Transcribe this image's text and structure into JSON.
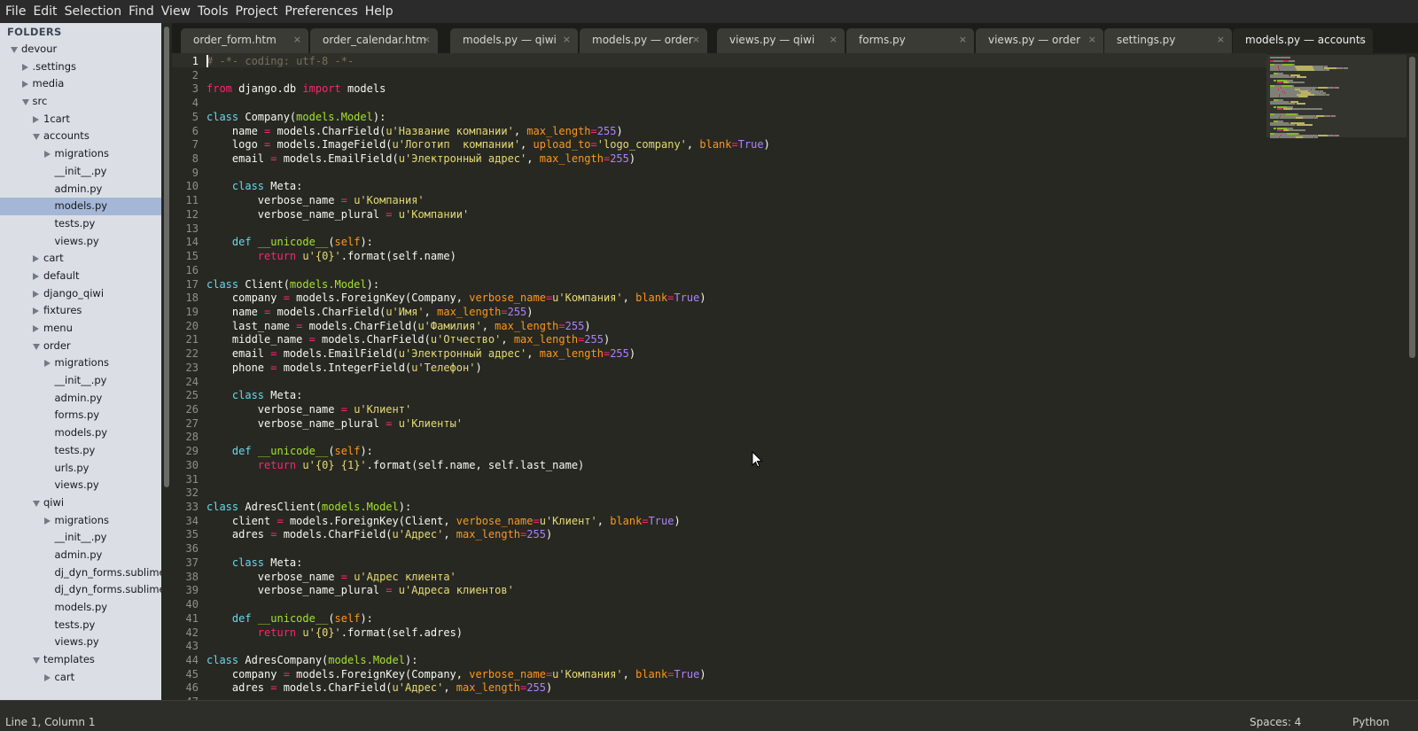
{
  "menu": [
    "File",
    "Edit",
    "Selection",
    "Find",
    "View",
    "Tools",
    "Project",
    "Preferences",
    "Help"
  ],
  "sidebar": {
    "header": "FOLDERS",
    "items": [
      {
        "label": "devour",
        "depth": 0,
        "type": "folder-open"
      },
      {
        "label": ".settings",
        "depth": 1,
        "type": "folder-closed"
      },
      {
        "label": "media",
        "depth": 1,
        "type": "folder-closed"
      },
      {
        "label": "src",
        "depth": 1,
        "type": "folder-open"
      },
      {
        "label": "1cart",
        "depth": 2,
        "type": "folder-closed"
      },
      {
        "label": "accounts",
        "depth": 2,
        "type": "folder-open"
      },
      {
        "label": "migrations",
        "depth": 3,
        "type": "folder-closed"
      },
      {
        "label": "__init__.py",
        "depth": 3,
        "type": "file"
      },
      {
        "label": "admin.py",
        "depth": 3,
        "type": "file"
      },
      {
        "label": "models.py",
        "depth": 3,
        "type": "file",
        "selected": true
      },
      {
        "label": "tests.py",
        "depth": 3,
        "type": "file"
      },
      {
        "label": "views.py",
        "depth": 3,
        "type": "file"
      },
      {
        "label": "cart",
        "depth": 2,
        "type": "folder-closed"
      },
      {
        "label": "default",
        "depth": 2,
        "type": "folder-closed"
      },
      {
        "label": "django_qiwi",
        "depth": 2,
        "type": "folder-closed"
      },
      {
        "label": "fixtures",
        "depth": 2,
        "type": "folder-closed"
      },
      {
        "label": "menu",
        "depth": 2,
        "type": "folder-closed"
      },
      {
        "label": "order",
        "depth": 2,
        "type": "folder-open"
      },
      {
        "label": "migrations",
        "depth": 3,
        "type": "folder-closed"
      },
      {
        "label": "__init__.py",
        "depth": 3,
        "type": "file"
      },
      {
        "label": "admin.py",
        "depth": 3,
        "type": "file"
      },
      {
        "label": "forms.py",
        "depth": 3,
        "type": "file"
      },
      {
        "label": "models.py",
        "depth": 3,
        "type": "file"
      },
      {
        "label": "tests.py",
        "depth": 3,
        "type": "file"
      },
      {
        "label": "urls.py",
        "depth": 3,
        "type": "file"
      },
      {
        "label": "views.py",
        "depth": 3,
        "type": "file"
      },
      {
        "label": "qiwi",
        "depth": 2,
        "type": "folder-open"
      },
      {
        "label": "migrations",
        "depth": 3,
        "type": "folder-closed"
      },
      {
        "label": "__init__.py",
        "depth": 3,
        "type": "file"
      },
      {
        "label": "admin.py",
        "depth": 3,
        "type": "file"
      },
      {
        "label": "dj_dyn_forms.sublime",
        "depth": 3,
        "type": "file"
      },
      {
        "label": "dj_dyn_forms.sublime",
        "depth": 3,
        "type": "file"
      },
      {
        "label": "models.py",
        "depth": 3,
        "type": "file"
      },
      {
        "label": "tests.py",
        "depth": 3,
        "type": "file"
      },
      {
        "label": "views.py",
        "depth": 3,
        "type": "file"
      },
      {
        "label": "templates",
        "depth": 2,
        "type": "folder-open"
      },
      {
        "label": "cart",
        "depth": 3,
        "type": "folder-closed"
      }
    ]
  },
  "tabs": [
    {
      "label": "order_form.htm",
      "active": false
    },
    {
      "label": "order_calendar.htm",
      "active": false
    },
    {
      "label": "models.py — qiwi",
      "active": false
    },
    {
      "label": "models.py — order",
      "active": false
    },
    {
      "label": "views.py — qiwi",
      "active": false
    },
    {
      "label": "forms.py",
      "active": false
    },
    {
      "label": "views.py — order",
      "active": false
    },
    {
      "label": "settings.py",
      "active": false
    },
    {
      "label": "models.py — accounts",
      "active": true
    }
  ],
  "tab_close_glyph": "×",
  "editor": {
    "lines": [
      [
        [
          "com",
          "# -*- coding: utf-8 -*-"
        ]
      ],
      [],
      [
        [
          "kw",
          "from"
        ],
        [
          "",
          " django.db "
        ],
        [
          "kw",
          "import"
        ],
        [
          "",
          " models"
        ]
      ],
      [],
      [
        [
          "def",
          "class"
        ],
        [
          "",
          " Company("
        ],
        [
          "cls",
          "models.Model"
        ],
        [
          "",
          "):"
        ]
      ],
      [
        [
          "",
          "    name "
        ],
        [
          "kw",
          "="
        ],
        [
          "",
          " models.CharField("
        ],
        [
          "str",
          "u'Название компании'"
        ],
        [
          "",
          ", "
        ],
        [
          "arg",
          "max_length"
        ],
        [
          "kw",
          "="
        ],
        [
          "num",
          "255"
        ],
        [
          "",
          ")"
        ]
      ],
      [
        [
          "",
          "    logo "
        ],
        [
          "kw",
          "="
        ],
        [
          "",
          " models.ImageField("
        ],
        [
          "str",
          "u'Логотип  компании'"
        ],
        [
          "",
          ", "
        ],
        [
          "arg",
          "upload_to"
        ],
        [
          "kw",
          "="
        ],
        [
          "str",
          "'logo_company'"
        ],
        [
          "",
          ", "
        ],
        [
          "arg",
          "blank"
        ],
        [
          "kw",
          "="
        ],
        [
          "num",
          "True"
        ],
        [
          "",
          ")"
        ]
      ],
      [
        [
          "",
          "    email "
        ],
        [
          "kw",
          "="
        ],
        [
          "",
          " models.EmailField("
        ],
        [
          "str",
          "u'Электронный адрес'"
        ],
        [
          "",
          ", "
        ],
        [
          "arg",
          "max_length"
        ],
        [
          "kw",
          "="
        ],
        [
          "num",
          "255"
        ],
        [
          "",
          ")"
        ]
      ],
      [],
      [
        [
          "",
          "    "
        ],
        [
          "def",
          "class"
        ],
        [
          "",
          " Meta:"
        ]
      ],
      [
        [
          "",
          "        verbose_name "
        ],
        [
          "kw",
          "="
        ],
        [
          "",
          " "
        ],
        [
          "str",
          "u'Компания'"
        ]
      ],
      [
        [
          "",
          "        verbose_name_plural "
        ],
        [
          "kw",
          "="
        ],
        [
          "",
          " "
        ],
        [
          "str",
          "u'Компании'"
        ]
      ],
      [],
      [
        [
          "",
          "    "
        ],
        [
          "def",
          "def"
        ],
        [
          "",
          " "
        ],
        [
          "cls",
          "__unicode__"
        ],
        [
          "",
          "("
        ],
        [
          "arg",
          "self"
        ],
        [
          "",
          "):"
        ]
      ],
      [
        [
          "",
          "        "
        ],
        [
          "kw",
          "return"
        ],
        [
          "",
          " "
        ],
        [
          "str",
          "u'{0}'"
        ],
        [
          "",
          ".format(self.name)"
        ]
      ],
      [],
      [
        [
          "def",
          "class"
        ],
        [
          "",
          " Client("
        ],
        [
          "cls",
          "models.Model"
        ],
        [
          "",
          "):"
        ]
      ],
      [
        [
          "",
          "    company "
        ],
        [
          "kw",
          "="
        ],
        [
          "",
          " models.ForeignKey(Company, "
        ],
        [
          "arg",
          "verbose_name"
        ],
        [
          "kw",
          "="
        ],
        [
          "str",
          "u'Компания'"
        ],
        [
          "",
          ", "
        ],
        [
          "arg",
          "blank"
        ],
        [
          "kw",
          "="
        ],
        [
          "num",
          "True"
        ],
        [
          "",
          ")"
        ]
      ],
      [
        [
          "",
          "    name "
        ],
        [
          "kw",
          "="
        ],
        [
          "",
          " models.CharField("
        ],
        [
          "str",
          "u'Имя'"
        ],
        [
          "",
          ", "
        ],
        [
          "arg",
          "max_length"
        ],
        [
          "kw",
          "="
        ],
        [
          "num",
          "255"
        ],
        [
          "",
          ")"
        ]
      ],
      [
        [
          "",
          "    last_name "
        ],
        [
          "kw",
          "="
        ],
        [
          "",
          " models.CharField("
        ],
        [
          "str",
          "u'Фамилия'"
        ],
        [
          "",
          ", "
        ],
        [
          "arg",
          "max_length"
        ],
        [
          "kw",
          "="
        ],
        [
          "num",
          "255"
        ],
        [
          "",
          ")"
        ]
      ],
      [
        [
          "",
          "    middle_name "
        ],
        [
          "kw",
          "="
        ],
        [
          "",
          " models.CharField("
        ],
        [
          "str",
          "u'Отчество'"
        ],
        [
          "",
          ", "
        ],
        [
          "arg",
          "max_length"
        ],
        [
          "kw",
          "="
        ],
        [
          "num",
          "255"
        ],
        [
          "",
          ")"
        ]
      ],
      [
        [
          "",
          "    email "
        ],
        [
          "kw",
          "="
        ],
        [
          "",
          " models.EmailField("
        ],
        [
          "str",
          "u'Электронный адрес'"
        ],
        [
          "",
          ", "
        ],
        [
          "arg",
          "max_length"
        ],
        [
          "kw",
          "="
        ],
        [
          "num",
          "255"
        ],
        [
          "",
          ")"
        ]
      ],
      [
        [
          "",
          "    phone "
        ],
        [
          "kw",
          "="
        ],
        [
          "",
          " models.IntegerField("
        ],
        [
          "str",
          "u'Телефон'"
        ],
        [
          "",
          ")"
        ]
      ],
      [],
      [
        [
          "",
          "    "
        ],
        [
          "def",
          "class"
        ],
        [
          "",
          " Meta:"
        ]
      ],
      [
        [
          "",
          "        verbose_name "
        ],
        [
          "kw",
          "="
        ],
        [
          "",
          " "
        ],
        [
          "str",
          "u'Клиент'"
        ]
      ],
      [
        [
          "",
          "        verbose_name_plural "
        ],
        [
          "kw",
          "="
        ],
        [
          "",
          " "
        ],
        [
          "str",
          "u'Клиенты'"
        ]
      ],
      [],
      [
        [
          "",
          "    "
        ],
        [
          "def",
          "def"
        ],
        [
          "",
          " "
        ],
        [
          "cls",
          "__unicode__"
        ],
        [
          "",
          "("
        ],
        [
          "arg",
          "self"
        ],
        [
          "",
          "):"
        ]
      ],
      [
        [
          "",
          "        "
        ],
        [
          "kw",
          "return"
        ],
        [
          "",
          " "
        ],
        [
          "str",
          "u'{0} {1}'"
        ],
        [
          "",
          ".format(self.name, self.last_name)"
        ]
      ],
      [],
      [],
      [
        [
          "def",
          "class"
        ],
        [
          "",
          " AdresClient("
        ],
        [
          "cls",
          "models.Model"
        ],
        [
          "",
          "):"
        ]
      ],
      [
        [
          "",
          "    client "
        ],
        [
          "kw",
          "="
        ],
        [
          "",
          " models.ForeignKey(Client, "
        ],
        [
          "arg",
          "verbose_name"
        ],
        [
          "kw",
          "="
        ],
        [
          "str",
          "u'Клиент'"
        ],
        [
          "",
          ", "
        ],
        [
          "arg",
          "blank"
        ],
        [
          "kw",
          "="
        ],
        [
          "num",
          "True"
        ],
        [
          "",
          ")"
        ]
      ],
      [
        [
          "",
          "    adres "
        ],
        [
          "kw",
          "="
        ],
        [
          "",
          " models.CharField("
        ],
        [
          "str",
          "u'Адрес'"
        ],
        [
          "",
          ", "
        ],
        [
          "arg",
          "max_length"
        ],
        [
          "kw",
          "="
        ],
        [
          "num",
          "255"
        ],
        [
          "",
          ")"
        ]
      ],
      [],
      [
        [
          "",
          "    "
        ],
        [
          "def",
          "class"
        ],
        [
          "",
          " Meta:"
        ]
      ],
      [
        [
          "",
          "        verbose_name "
        ],
        [
          "kw",
          "="
        ],
        [
          "",
          " "
        ],
        [
          "str",
          "u'Адрес клиента'"
        ]
      ],
      [
        [
          "",
          "        verbose_name_plural "
        ],
        [
          "kw",
          "="
        ],
        [
          "",
          " "
        ],
        [
          "str",
          "u'Адреса клиентов'"
        ]
      ],
      [],
      [
        [
          "",
          "    "
        ],
        [
          "def",
          "def"
        ],
        [
          "",
          " "
        ],
        [
          "cls",
          "__unicode__"
        ],
        [
          "",
          "("
        ],
        [
          "arg",
          "self"
        ],
        [
          "",
          "):"
        ]
      ],
      [
        [
          "",
          "        "
        ],
        [
          "kw",
          "return"
        ],
        [
          "",
          " "
        ],
        [
          "str",
          "u'{0}'"
        ],
        [
          "",
          ".format(self.adres)"
        ]
      ],
      [],
      [
        [
          "def",
          "class"
        ],
        [
          "",
          " AdresCompany("
        ],
        [
          "cls",
          "models.Model"
        ],
        [
          "",
          "):"
        ]
      ],
      [
        [
          "",
          "    company "
        ],
        [
          "kw",
          "="
        ],
        [
          "",
          " models.ForeignKey(Company, "
        ],
        [
          "arg",
          "verbose_name"
        ],
        [
          "kw",
          "="
        ],
        [
          "str",
          "u'Компания'"
        ],
        [
          "",
          ", "
        ],
        [
          "arg",
          "blank"
        ],
        [
          "kw",
          "="
        ],
        [
          "num",
          "True"
        ],
        [
          "",
          ")"
        ]
      ],
      [
        [
          "",
          "    adres "
        ],
        [
          "kw",
          "="
        ],
        [
          "",
          " models.CharField("
        ],
        [
          "str",
          "u'Адрес'"
        ],
        [
          "",
          ", "
        ],
        [
          "arg",
          "max_length"
        ],
        [
          "kw",
          "="
        ],
        [
          "num",
          "255"
        ],
        [
          "",
          ")"
        ]
      ],
      []
    ]
  },
  "status": {
    "position": "Line 1, Column 1",
    "spaces": "Spaces: 4",
    "syntax": "Python"
  },
  "colors": {
    "background": "#272822",
    "keyword": "#f92672",
    "class_keyword": "#66d9ef",
    "class_name": "#a6e22e",
    "string": "#e6db74",
    "number": "#ae81ff",
    "argument": "#fd971f",
    "comment": "#75715e"
  }
}
